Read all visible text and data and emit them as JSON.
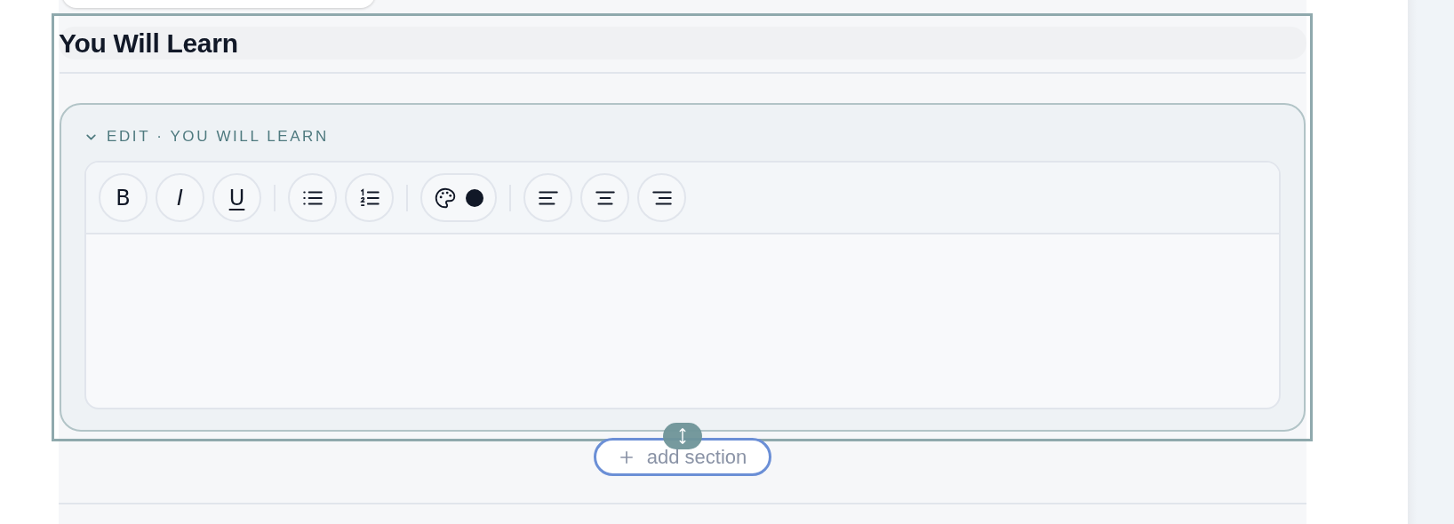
{
  "section": {
    "selected": true,
    "heading": "You Will Learn",
    "editor": {
      "title": "EDIT · YOU WILL LEARN",
      "expanded": true,
      "toolbar": [
        {
          "buttons": [
            {
              "kind": "bold",
              "label": "B"
            },
            {
              "kind": "italic",
              "label": "I"
            },
            {
              "kind": "underline",
              "label": "U"
            }
          ]
        },
        {
          "buttons": [
            {
              "kind": "bullet-list"
            },
            {
              "kind": "numbered-list"
            }
          ]
        },
        {
          "buttons": [
            {
              "kind": "text-color",
              "color": "#111827"
            }
          ]
        },
        {
          "buttons": [
            {
              "kind": "align-left"
            },
            {
              "kind": "align-center"
            },
            {
              "kind": "align-right"
            }
          ]
        }
      ]
    }
  },
  "add_section": {
    "label": "add section"
  }
}
